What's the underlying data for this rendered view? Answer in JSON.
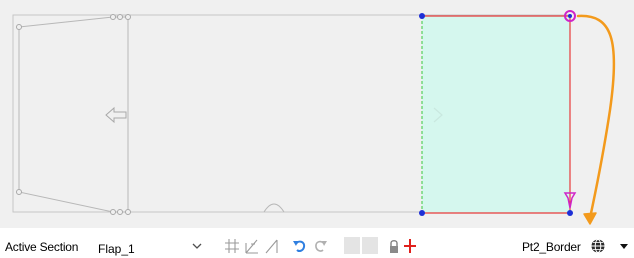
{
  "app": {
    "active_section_label": "Active Section",
    "active_section_value": "Flap_1",
    "point_label": "Pt2_Border"
  },
  "icons": {
    "dropdown": "chevron-down-icon",
    "grid_snap": "grid-snap-icon",
    "angle_snap": "angle-snap-icon",
    "line_snap": "line-snap-icon",
    "undo": "undo-icon",
    "redo": "redo-icon",
    "lock": "lock-icon",
    "pin": "red-pin-icon",
    "globe": "globe-icon",
    "menu_arrow": "caret-down-icon"
  },
  "colors": {
    "canvas_bg": "#f0f0f0",
    "section_fill": "#d5f7ee",
    "section_border": "#e83a3a",
    "shape_line": "#b8b8b8",
    "dashed_edge": "#3cc93c",
    "vertex": "#1d2fd6",
    "selected_vertex": "#d024c8",
    "callout_arrow": "#f39a1c"
  }
}
